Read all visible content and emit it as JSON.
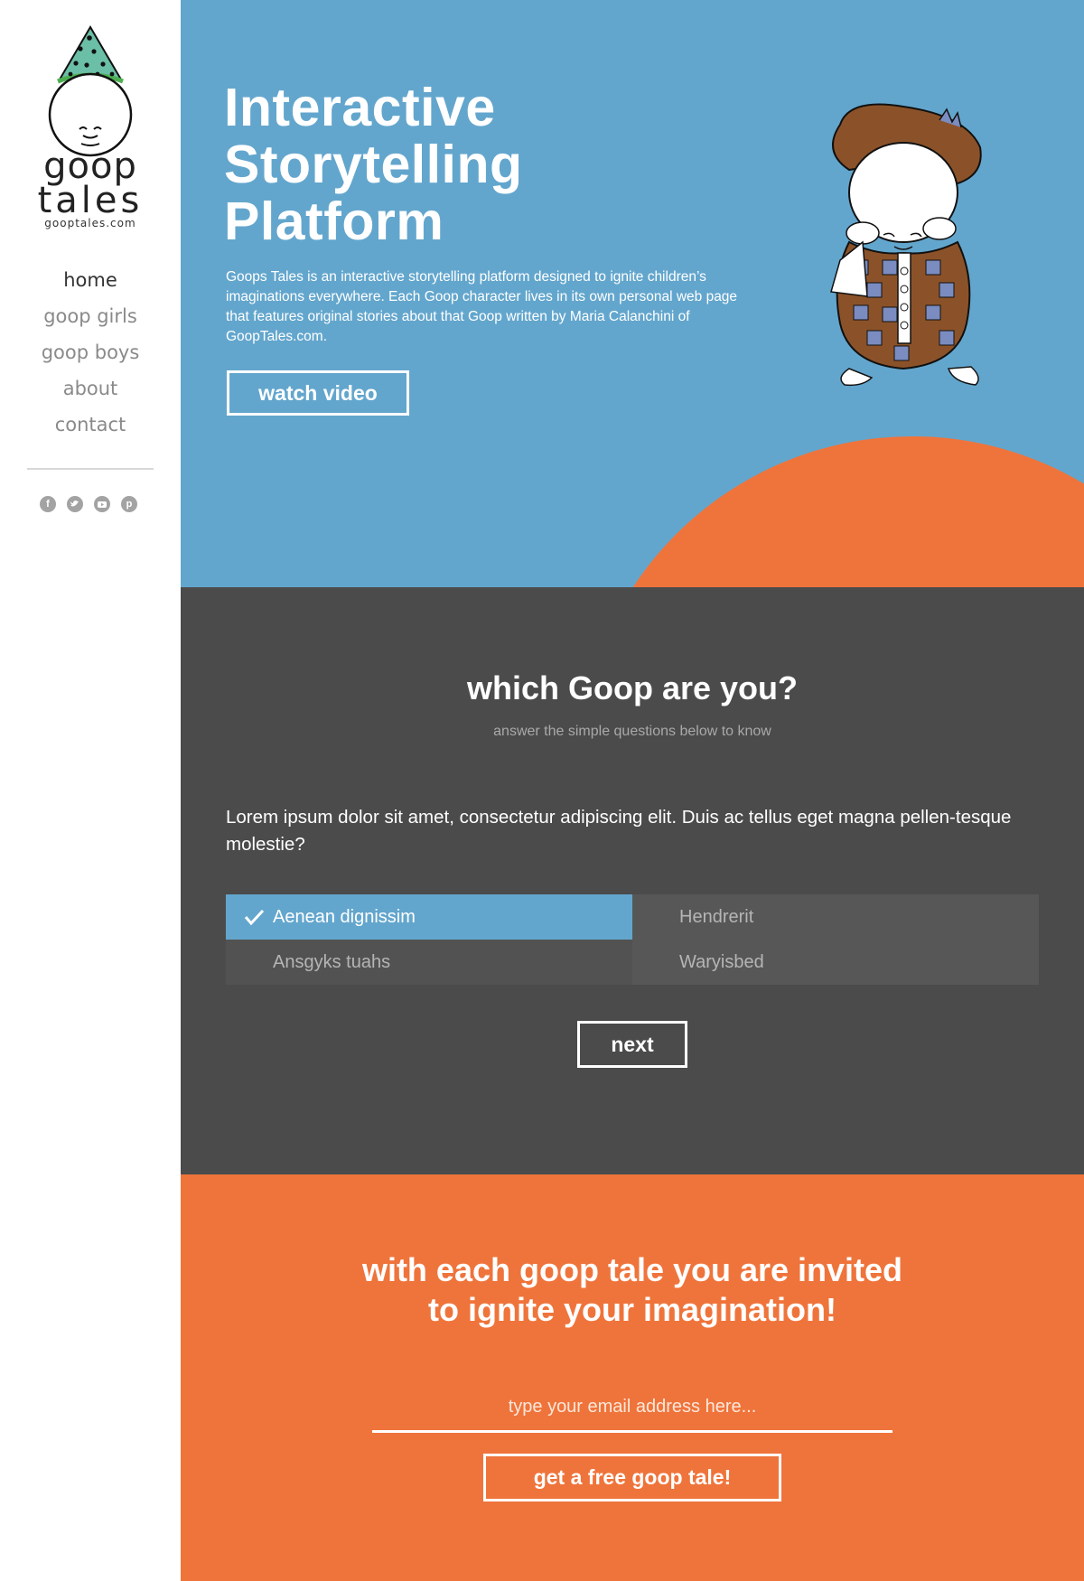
{
  "sidebar": {
    "logo": {
      "word1": "goop",
      "word2": "tales",
      "domain": "gooptales.com"
    },
    "nav": [
      {
        "label": "home",
        "active": true
      },
      {
        "label": "goop girls"
      },
      {
        "label": "goop boys"
      },
      {
        "label": "about"
      },
      {
        "label": "contact"
      }
    ],
    "social": [
      "facebook-icon",
      "twitter-icon",
      "youtube-icon",
      "pinterest-icon"
    ]
  },
  "hero": {
    "title": "Interactive Storytelling Platform",
    "description": "Goops Tales is an interactive storytelling platform designed to ignite children’s imaginations everywhere. Each Goop character lives in its own personal web page that features original stories about that Goop written by Maria Calanchini of GoopTales.com.",
    "button": "watch video"
  },
  "quiz": {
    "title": "which Goop are you?",
    "subtitle": "answer the simple questions below to know",
    "question": "Lorem ipsum dolor sit amet, consectetur adipiscing elit. Duis ac tellus eget magna pellen-tesque molestie?",
    "options": [
      {
        "label": "Aenean dignissim",
        "selected": true
      },
      {
        "label": "Hendrerit"
      },
      {
        "label": "Ansgyks tuahs"
      },
      {
        "label": "Waryisbed"
      }
    ],
    "next": "next"
  },
  "invite": {
    "title_line1": "with each goop tale you are invited",
    "title_line2": "to ignite your imagination!",
    "email_placeholder": "type your email address here...",
    "button": "get a free goop tale!"
  },
  "colors": {
    "hero_blue": "#63a6cd",
    "quiz_gray": "#4b4b4b",
    "accent_orange": "#ef743b"
  }
}
